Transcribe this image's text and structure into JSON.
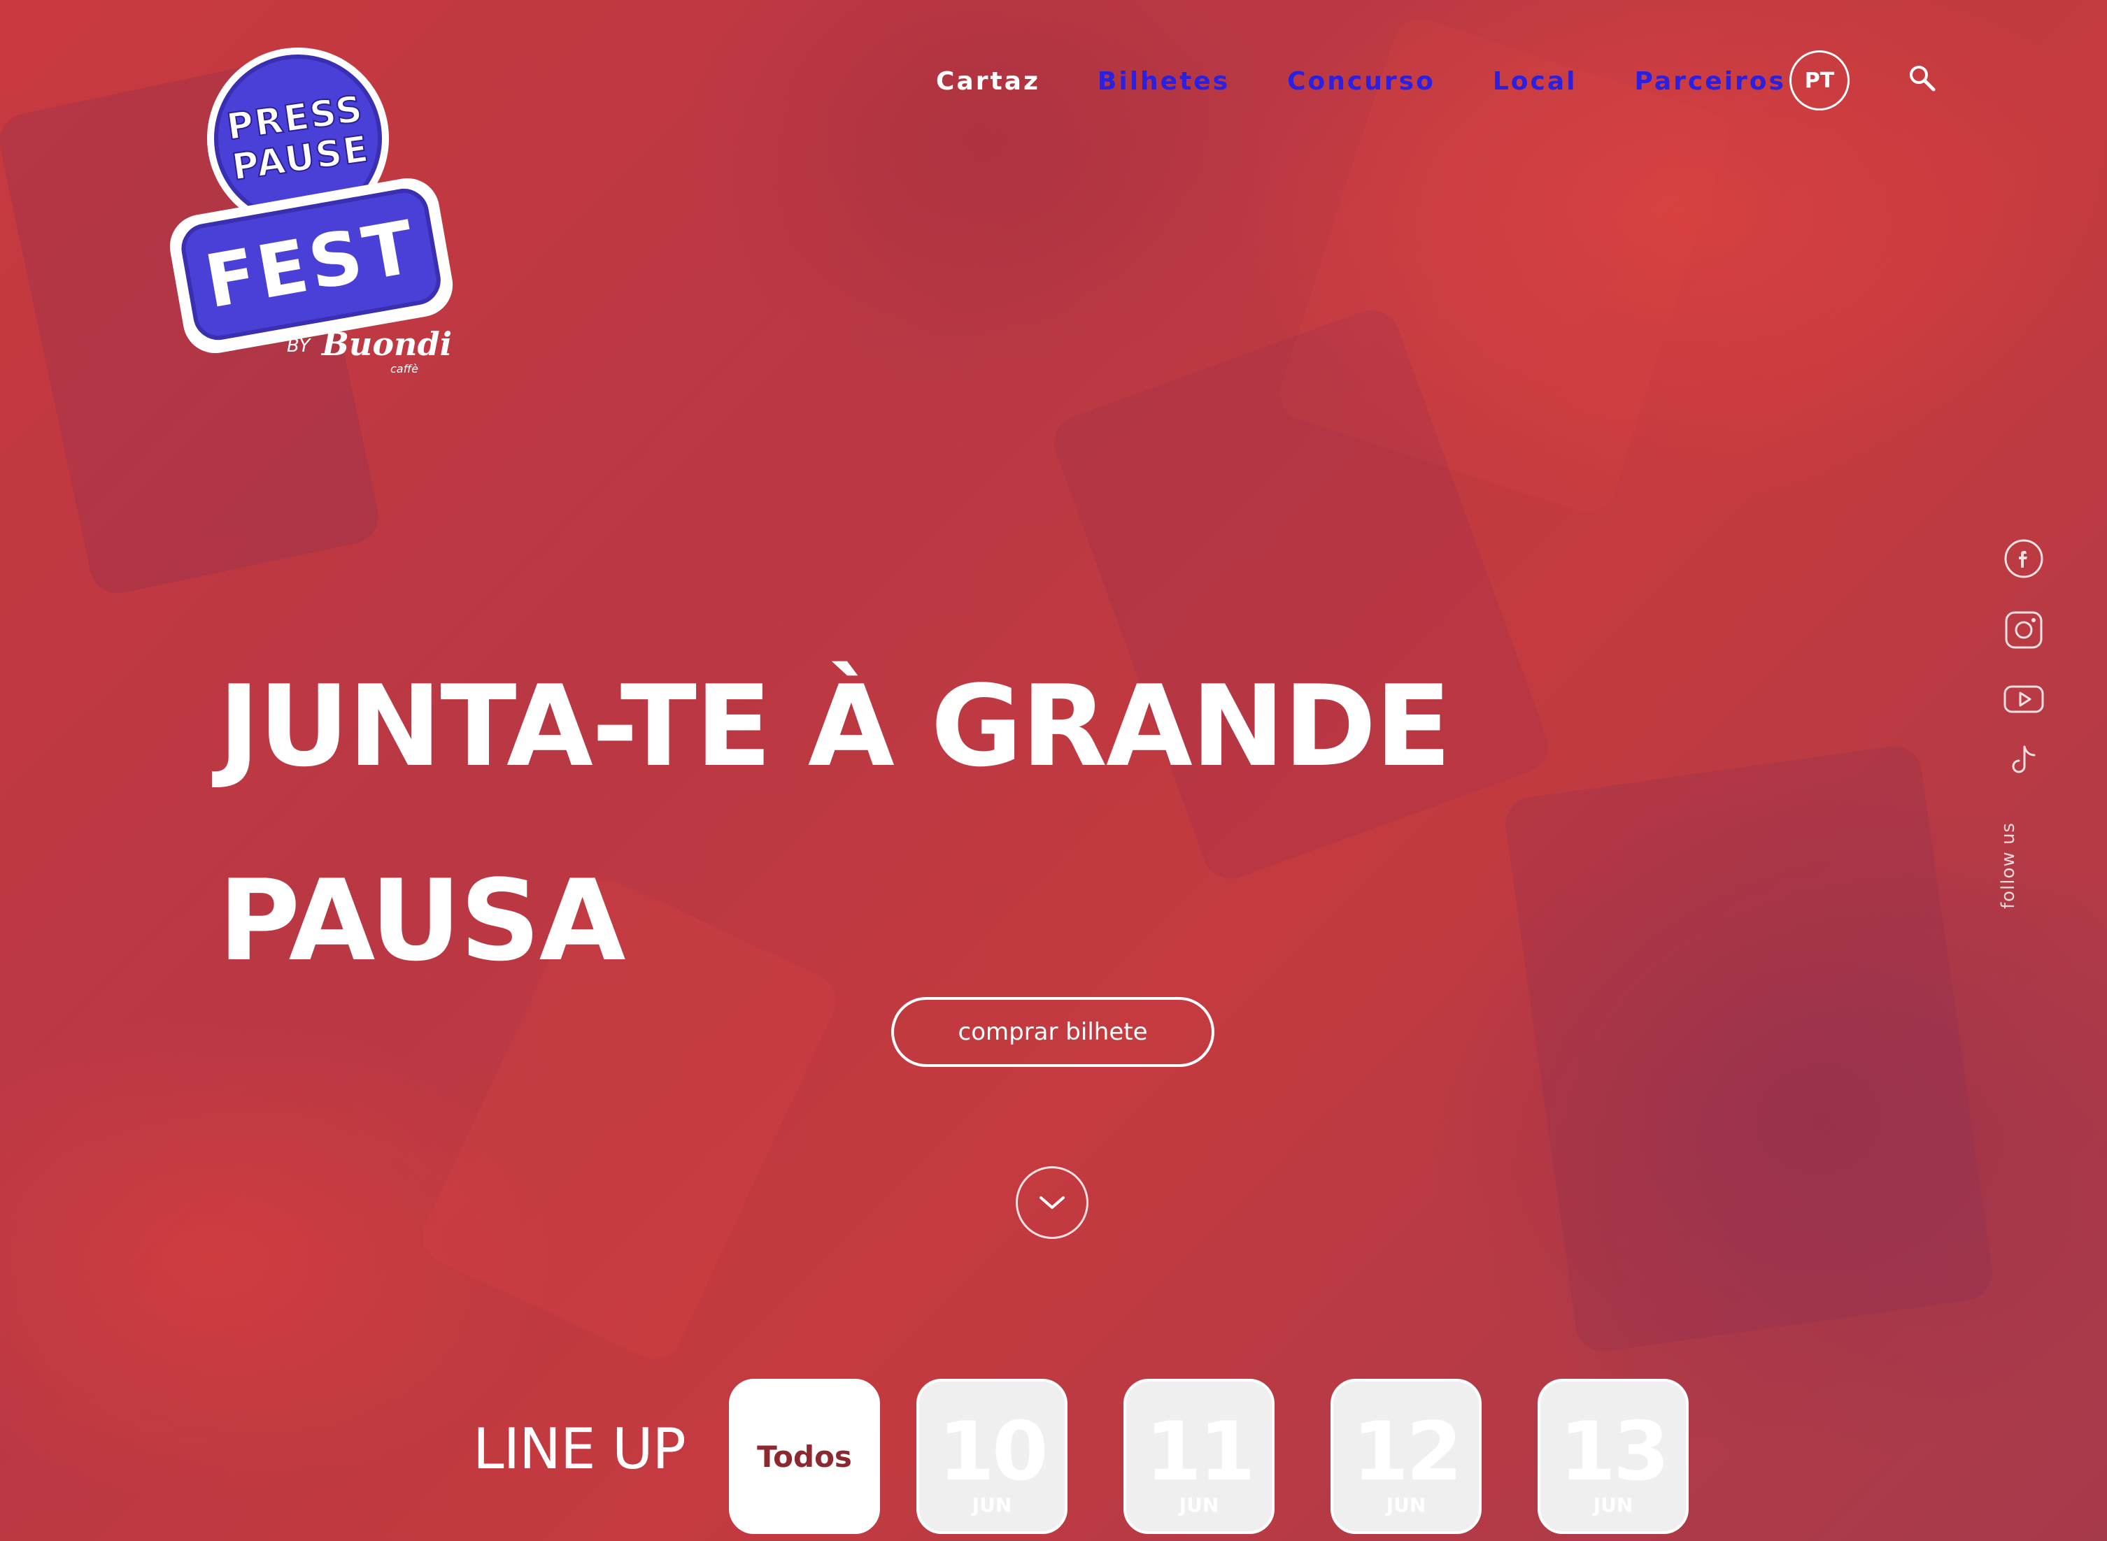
{
  "brand": {
    "logo_line1": "PRESS",
    "logo_line2": "PAUSE",
    "logo_fest": "FEST",
    "logo_by": "BY",
    "logo_brand": "Buondi",
    "logo_caffe": "caffè"
  },
  "nav": {
    "items": [
      {
        "label": "Cartaz",
        "active": true
      },
      {
        "label": "Bilhetes",
        "active": false
      },
      {
        "label": "Concurso",
        "active": false
      },
      {
        "label": "Local",
        "active": false
      },
      {
        "label": "Parceiros",
        "active": false
      }
    ],
    "language": "PT",
    "search_icon": "search-icon"
  },
  "hero": {
    "headline_line1": "JUNTA-TE À GRANDE",
    "headline_line2": "PAUSA",
    "cta_label": "comprar bilhete",
    "scroll_icon": "chevron-down-icon"
  },
  "social": {
    "icons": [
      "facebook-icon",
      "instagram-icon",
      "youtube-icon",
      "tiktok-icon"
    ],
    "follow_label": "follow us"
  },
  "lineup": {
    "label": "LINE UP",
    "all_label": "Todos",
    "days": [
      {
        "day": "10",
        "month": "JUN"
      },
      {
        "day": "11",
        "month": "JUN"
      },
      {
        "day": "12",
        "month": "JUN"
      },
      {
        "day": "13",
        "month": "JUN"
      }
    ]
  },
  "colors": {
    "background": "#c0393f",
    "nav_link": "#2b1fe0",
    "logo_blue": "#4a3fd6",
    "selected_text": "#8e2830"
  }
}
